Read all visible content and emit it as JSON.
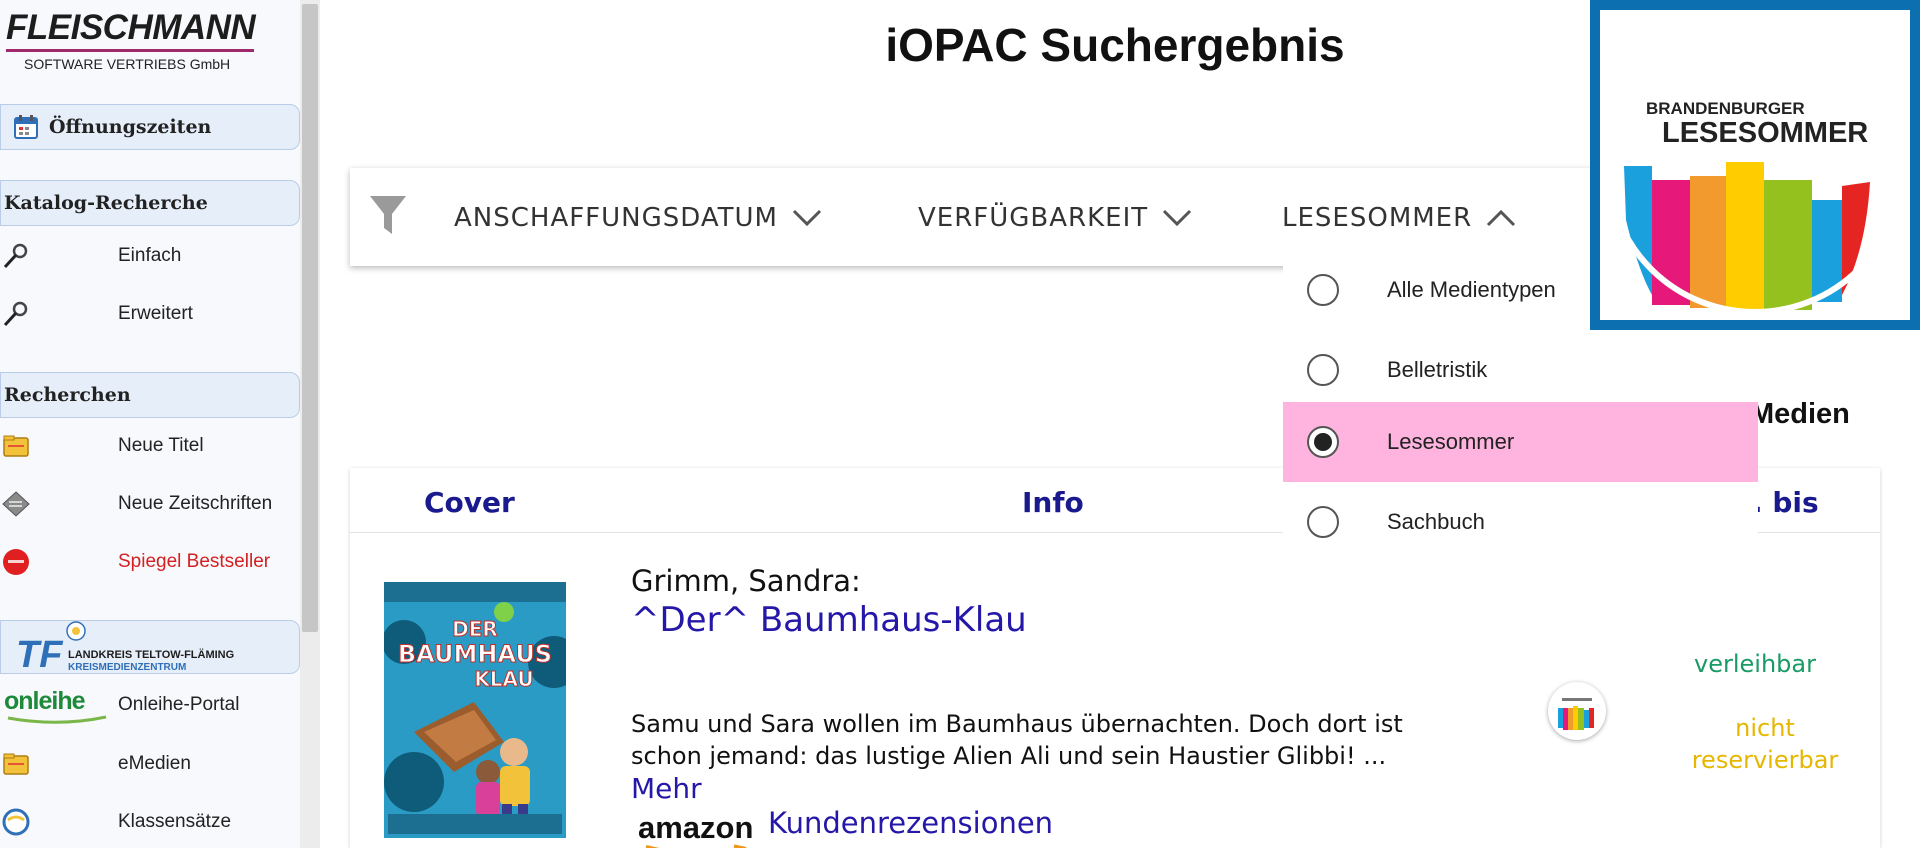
{
  "brand": {
    "name": "FLEISCHMANN",
    "subtitle": "SOFTWARE VERTRIEBS GmbH"
  },
  "sidebar": {
    "hours": {
      "label": "Öffnungszeiten",
      "icon": "calendar-icon"
    },
    "sections": [
      {
        "title": "Katalog-Recherche",
        "items": [
          {
            "label": "Einfach",
            "icon": "magnifier-icon"
          },
          {
            "label": "Erweitert",
            "icon": "magnifier-icon"
          }
        ]
      },
      {
        "title": "Recherchen",
        "items": [
          {
            "label": "Neue Titel",
            "icon": "folder-icon"
          },
          {
            "label": "Neue Zeitschriften",
            "icon": "newspaper-icon"
          },
          {
            "label": "Spiegel Bestseller",
            "icon": "spiegel-icon",
            "color": "#d42020"
          }
        ]
      }
    ],
    "partner": {
      "logo_line1": "LANDKREIS TELTOW-FLÄMING",
      "logo_line2": "KREISMEDIENZENTRUM",
      "logo_letters": "TF",
      "items": [
        {
          "label": "Onleihe-Portal",
          "icon": "onleihe-logo"
        },
        {
          "label": "eMedien",
          "icon": "folder-icon"
        },
        {
          "label": "Klassensätze",
          "icon": "globe-icon"
        }
      ]
    },
    "onleihe_logo_text": "onleihe"
  },
  "page": {
    "title": "iOPAC Suchergebnis"
  },
  "filters": {
    "icon": "filter-icon",
    "tabs": [
      {
        "label": "ANSCHAFFUNGSDATUM",
        "state": "collapsed"
      },
      {
        "label": "VERFÜGBARKEIT",
        "state": "collapsed"
      },
      {
        "label": "LESESOMMER",
        "state": "expanded"
      }
    ],
    "lesesommer_options": [
      {
        "label": "Alle Medientypen",
        "selected": false
      },
      {
        "label": "Belletristik",
        "selected": false
      },
      {
        "label": "Lesesommer",
        "selected": true
      },
      {
        "label": "Sachbuch",
        "selected": false
      }
    ]
  },
  "logo": {
    "line1": "BRANDENBURGER",
    "line2": "LESESOMMER",
    "frame_color": "#0c6fb0"
  },
  "results": {
    "count_label_partial": "Medien",
    "headers": {
      "cover": "Cover",
      "info": "Info",
      "bis_partial": ". bis"
    },
    "items": [
      {
        "author": "Grimm, Sandra:",
        "title": "^Der^ Baumhaus-Klau",
        "description_line1": "Samu und Sara wollen im Baumhaus übernachten. Doch dort ist",
        "description_line2": "schon jemand: das lustige Alien Ali und sein Haustier Glibbi! ...",
        "more": "Mehr",
        "amazon": "amazon",
        "reviews": "Kundenrezensionen",
        "status_available": "verleihbar",
        "status_reserve_1": "nicht",
        "status_reserve_2": "reservierbar",
        "cover_title_1": "DER",
        "cover_title_2": "BAUMHAUS",
        "cover_title_3": "KLAU"
      }
    ]
  },
  "colors": {
    "link": "#2518a8",
    "header": "#1a1a8f",
    "available": "#1a9a66",
    "not_reservable": "#e6b700",
    "selected_option": "#ffb4df"
  }
}
